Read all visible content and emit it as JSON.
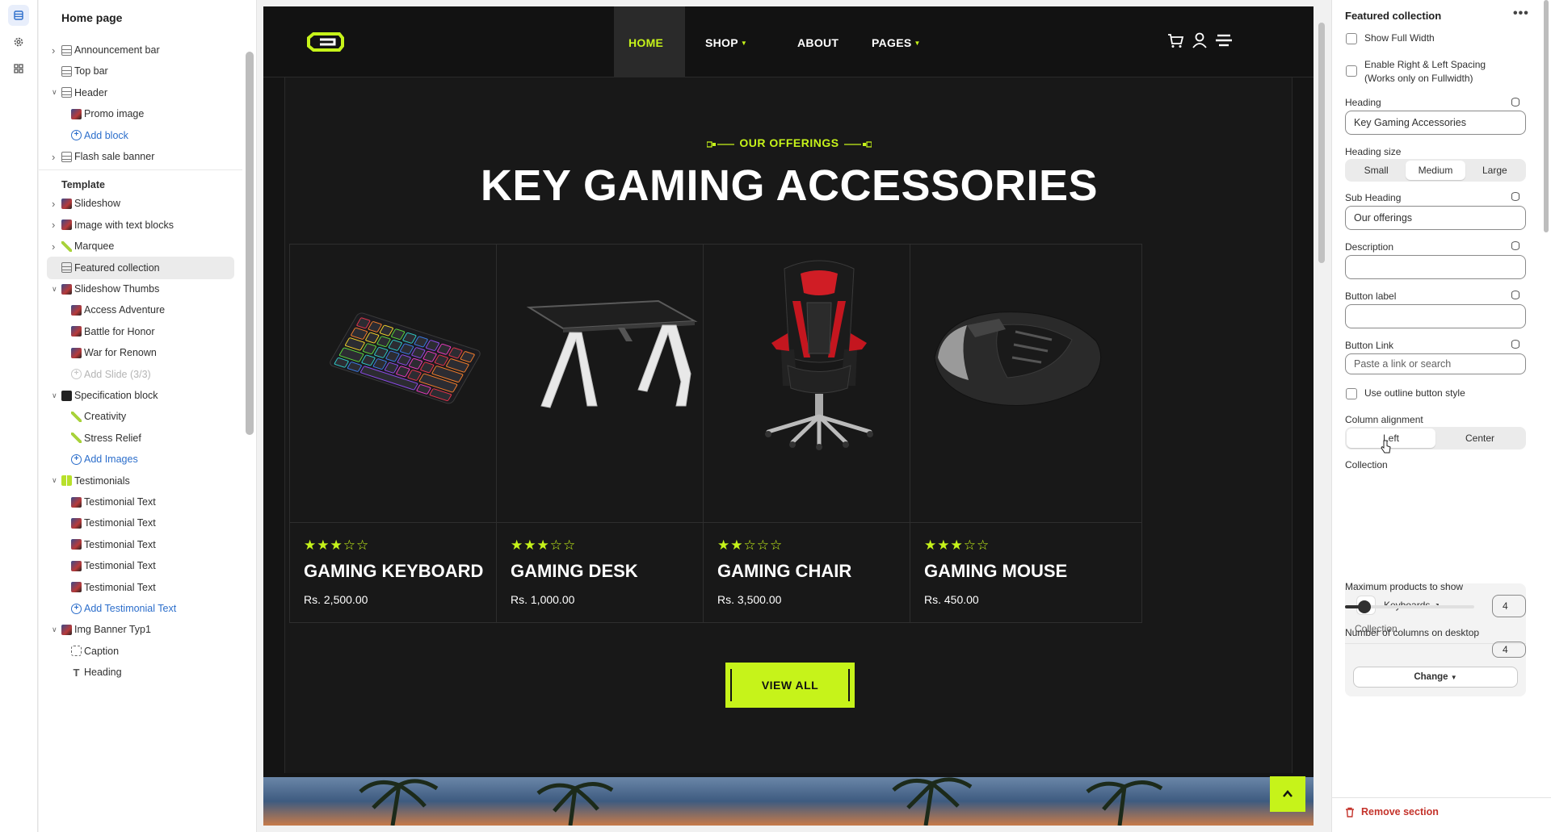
{
  "rail": {
    "icons": [
      "sections-icon",
      "settings-icon",
      "apps-icon"
    ]
  },
  "sidebar": {
    "title": "Home page",
    "header_items": [
      {
        "label": "Announcement bar",
        "icon": "section-icon",
        "chevron": true,
        "indent": 0
      },
      {
        "label": "Top bar",
        "icon": "section-icon",
        "chevron": false,
        "indent": 0
      },
      {
        "label": "Header",
        "icon": "section-icon",
        "chevron": true,
        "expanded": true,
        "indent": 0
      },
      {
        "label": "Promo image",
        "icon": "image-icon",
        "indent": 1
      },
      {
        "label": "Add block",
        "icon": "plus-icon",
        "indent": 1,
        "add": true
      },
      {
        "label": "Flash sale banner",
        "icon": "section-icon",
        "chevron": true,
        "indent": 0
      }
    ],
    "template_label": "Template",
    "template_items": [
      {
        "label": "Slideshow",
        "icon": "image-icon",
        "chevron": true,
        "indent": 0
      },
      {
        "label": "Image with text blocks",
        "icon": "image-icon",
        "chevron": true,
        "indent": 0
      },
      {
        "label": "Marquee",
        "icon": "marquee-icon",
        "chevron": true,
        "indent": 0
      },
      {
        "label": "Featured collection",
        "icon": "section-icon",
        "indent": 0,
        "selected": true
      },
      {
        "label": "Slideshow Thumbs",
        "icon": "image-icon",
        "chevron": true,
        "expanded": true,
        "indent": 0
      },
      {
        "label": "Access Adventure",
        "icon": "image-icon",
        "indent": 1
      },
      {
        "label": "Battle for Honor",
        "icon": "image-icon",
        "indent": 1
      },
      {
        "label": "War for Renown",
        "icon": "image-icon",
        "indent": 1
      },
      {
        "label": "Add Slide (3/3)",
        "icon": "plus-icon",
        "indent": 1,
        "disabled": true
      },
      {
        "label": "Specification block",
        "icon": "dark-icon",
        "chevron": true,
        "expanded": true,
        "indent": 0
      },
      {
        "label": "Creativity",
        "icon": "pen-icon",
        "indent": 1
      },
      {
        "label": "Stress Relief",
        "icon": "pen-icon",
        "indent": 1
      },
      {
        "label": "Add Images",
        "icon": "plus-icon",
        "indent": 1,
        "add": true
      },
      {
        "label": "Testimonials",
        "icon": "testimonial-icon",
        "chevron": true,
        "expanded": true,
        "indent": 0
      },
      {
        "label": "Testimonial Text",
        "icon": "image-icon",
        "indent": 1
      },
      {
        "label": "Testimonial Text",
        "icon": "image-icon",
        "indent": 1
      },
      {
        "label": "Testimonial Text",
        "icon": "image-icon",
        "indent": 1
      },
      {
        "label": "Testimonial Text",
        "icon": "image-icon",
        "indent": 1
      },
      {
        "label": "Testimonial Text",
        "icon": "image-icon",
        "indent": 1
      },
      {
        "label": "Add Testimonial Text",
        "icon": "plus-icon",
        "indent": 1,
        "add": true
      },
      {
        "label": "Img Banner Typ1",
        "icon": "image-icon",
        "chevron": true,
        "expanded": true,
        "indent": 0
      },
      {
        "label": "Caption",
        "icon": "caption-icon",
        "indent": 1
      },
      {
        "label": "Heading",
        "icon": "text-icon",
        "indent": 1
      }
    ]
  },
  "preview": {
    "nav": [
      {
        "label": "HOME",
        "active": true,
        "dropdown": false
      },
      {
        "label": "SHOP",
        "dropdown": true
      },
      {
        "label": "ABOUT",
        "dropdown": false
      },
      {
        "label": "PAGES",
        "dropdown": true
      }
    ],
    "subheading": "OUR OFFERINGS",
    "heading": "KEY GAMING ACCESSORIES",
    "products": [
      {
        "name": "GAMING KEYBOARD",
        "price": "Rs. 2,500.00",
        "rating": 3,
        "max_rating": 5,
        "image": "keyboard"
      },
      {
        "name": "GAMING DESK",
        "price": "Rs. 1,000.00",
        "rating": 3,
        "max_rating": 5,
        "image": "desk"
      },
      {
        "name": "GAMING CHAIR",
        "price": "Rs. 3,500.00",
        "rating": 2,
        "max_rating": 5,
        "image": "chair"
      },
      {
        "name": "GAMING MOUSE",
        "price": "Rs. 450.00",
        "rating": 3,
        "max_rating": 5,
        "image": "mouse"
      }
    ],
    "view_all": "VIEW ALL",
    "accent": "#c6f31a"
  },
  "settings": {
    "title": "Featured collection",
    "more": "•••",
    "show_full_width": "Show Full Width",
    "spacing_label": "Enable Right & Left Spacing (Works only on Fullwidth)",
    "heading_label": "Heading",
    "heading_value": "Key Gaming Accessories",
    "heading_size_label": "Heading size",
    "heading_sizes": [
      "Small",
      "Medium",
      "Large"
    ],
    "heading_size_selected": "Medium",
    "subheading_label": "Sub Heading",
    "subheading_value": "Our offerings",
    "description_label": "Description",
    "button_label_label": "Button label",
    "button_link_label": "Button Link",
    "button_link_placeholder": "Paste a link or search",
    "outline_label": "Use outline button style",
    "column_alignment_label": "Column alignment",
    "column_alignments": [
      "Left",
      "Center"
    ],
    "column_alignment_selected": "Left",
    "collection_label": "Collection",
    "collection_name": "Keyboards",
    "collection_sub": "Collection",
    "change_label": "Change",
    "max_products_label": "Maximum products to show",
    "max_products_value": "4",
    "max_products_fraction": 0.15,
    "columns_desktop_label": "Number of columns on desktop",
    "columns_desktop_value": "4",
    "remove_label": "Remove section"
  }
}
